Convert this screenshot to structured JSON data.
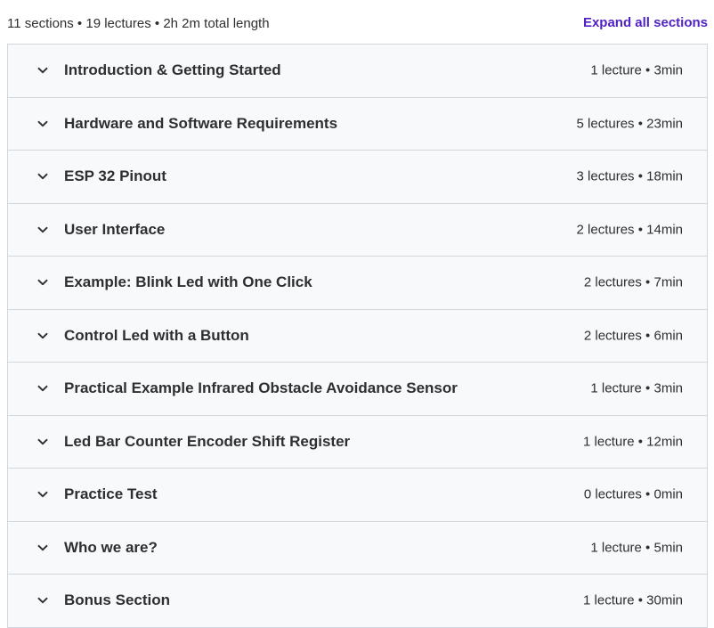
{
  "summary": {
    "text": "11 sections • 19 lectures • 2h 2m total length",
    "expand_label": "Expand all sections"
  },
  "sections": [
    {
      "title": "Introduction & Getting Started",
      "meta": "1 lecture • 3min"
    },
    {
      "title": "Hardware and Software Requirements",
      "meta": "5 lectures • 23min"
    },
    {
      "title": "ESP 32 Pinout",
      "meta": "3 lectures • 18min"
    },
    {
      "title": "User Interface",
      "meta": "2 lectures • 14min"
    },
    {
      "title": "Example: Blink Led with One Click",
      "meta": "2 lectures • 7min"
    },
    {
      "title": "Control Led with a Button",
      "meta": "2 lectures • 6min"
    },
    {
      "title": "Practical Example Infrared Obstacle Avoidance Sensor",
      "meta": "1 lecture • 3min"
    },
    {
      "title": "Led Bar Counter Encoder Shift Register",
      "meta": "1 lecture • 12min"
    },
    {
      "title": "Practice Test",
      "meta": "0 lectures • 0min"
    },
    {
      "title": "Who we are?",
      "meta": "1 lecture • 5min"
    },
    {
      "title": "Bonus Section",
      "meta": "1 lecture • 30min"
    }
  ],
  "icons": {
    "row_toggle": "chevron-down-icon"
  },
  "colors": {
    "accent": "#5022c3",
    "row_background": "#f7f9fa",
    "border": "#d1d7dc",
    "text": "#2d2f31"
  }
}
